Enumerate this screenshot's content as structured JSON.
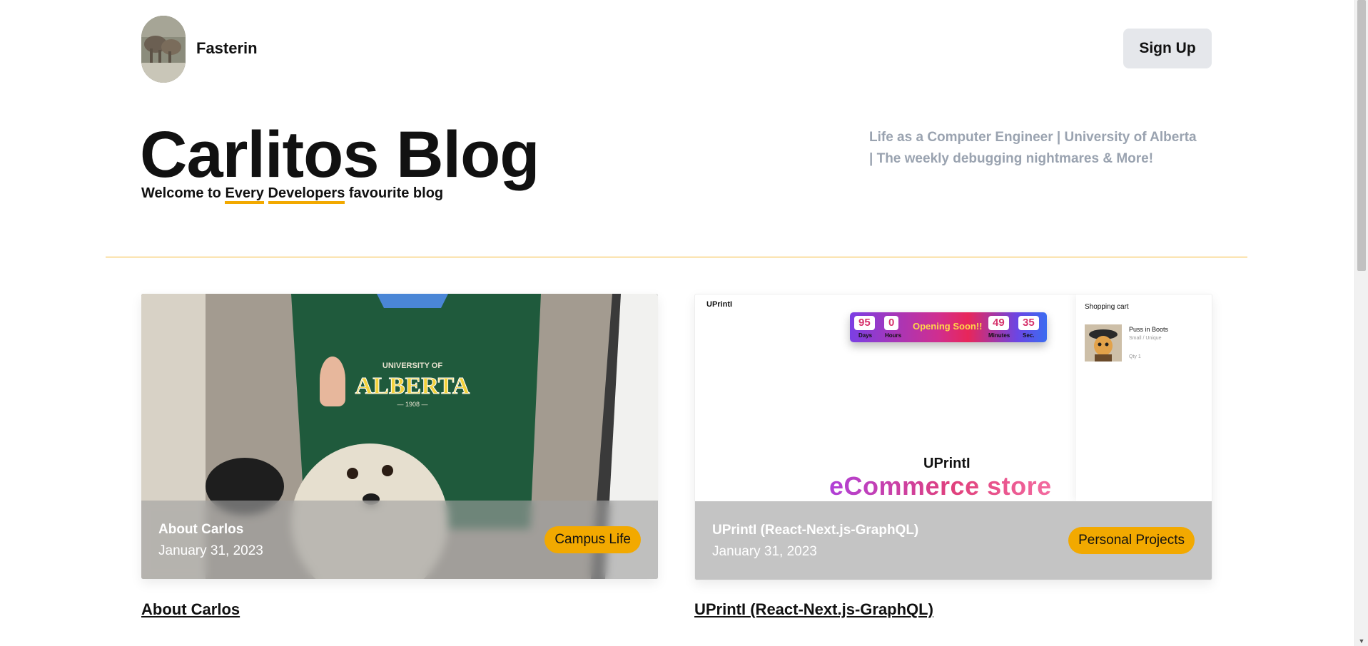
{
  "header": {
    "brand": "Fasterin",
    "signup_label": "Sign Up"
  },
  "hero": {
    "title": "Carlitos Blog",
    "welcome_prefix": "Welcome to ",
    "welcome_w1": "Every",
    "welcome_w2": "Developers",
    "welcome_suffix": " favourite blog",
    "tagline_line1": "Life as a Computer Engineer | University of Alberta",
    "tagline_line2": "| The weekly debugging nightmares & More!"
  },
  "posts": [
    {
      "title": "About Carlos",
      "date": "January 31, 2023",
      "category": "Campus Life",
      "hoodie_text": "UNIVERSITY OF",
      "hoodie_big": "ALBERTA",
      "hoodie_year": "— 1908 —"
    },
    {
      "title": "UPrintI (React-Next.js-GraphQL)",
      "date": "January 31, 2023",
      "category": "Personal Projects",
      "mock": {
        "logo": "UPrintI",
        "countdown": {
          "days": "95",
          "days_label": "Days",
          "hours": "0",
          "hours_label": "Hours",
          "middle": "Opening Soon!!",
          "minutes": "49",
          "minutes_label": "Minutes",
          "seconds": "35",
          "seconds_label": "Sec."
        },
        "cart_title": "Shopping cart",
        "cart_item": "Puss in Boots",
        "cart_sub": "Small / Unique",
        "cart_qty": "Qty 1",
        "brand": "UPrintI",
        "headline": "eCommerce store"
      }
    }
  ],
  "colors": {
    "accent": "#f2a900",
    "tagline": "#9aa3b0",
    "divider": "#f5b731",
    "signup_bg": "#e5e7eb"
  }
}
